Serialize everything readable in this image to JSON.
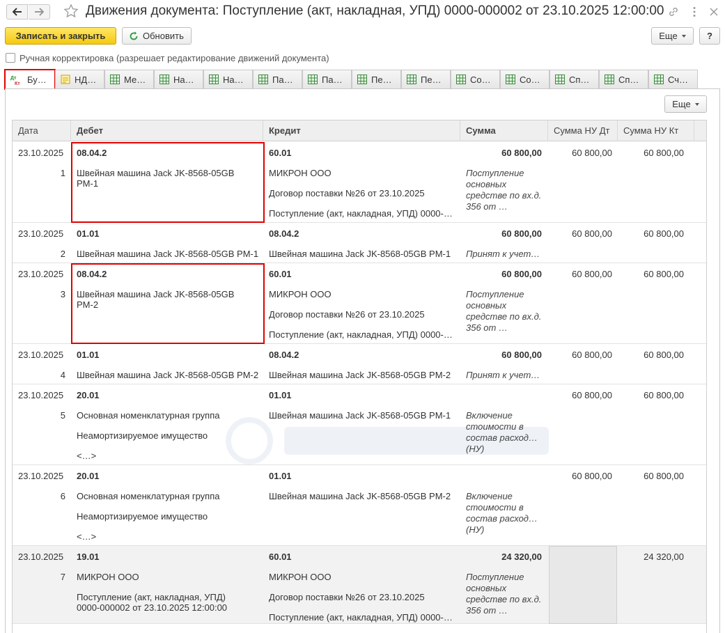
{
  "window": {
    "title": "Движения документа: Поступление (акт, накладная, УПД) 0000-000002 от 23.10.2025 12:00:00"
  },
  "toolbar": {
    "post_close": "Записать и закрыть",
    "refresh": "Обновить",
    "more": "Еще",
    "help": "?"
  },
  "manual_correction": {
    "label": "Ручная корректировка (разрешает редактирование движений документа)",
    "checked": false
  },
  "tabs": [
    {
      "label": "Бу…",
      "icon": "dt-kt-icon",
      "active": true
    },
    {
      "label": "НД…",
      "icon": "register-note-icon"
    },
    {
      "label": "Ме…",
      "icon": "table-icon"
    },
    {
      "label": "На…",
      "icon": "table-icon"
    },
    {
      "label": "На…",
      "icon": "table-icon"
    },
    {
      "label": "Па…",
      "icon": "table-icon"
    },
    {
      "label": "Па…",
      "icon": "table-icon"
    },
    {
      "label": "Пе…",
      "icon": "table-icon"
    },
    {
      "label": "Пе…",
      "icon": "table-icon"
    },
    {
      "label": "Со…",
      "icon": "table-icon"
    },
    {
      "label": "Со…",
      "icon": "table-icon"
    },
    {
      "label": "Сп…",
      "icon": "table-icon"
    },
    {
      "label": "Сп…",
      "icon": "table-icon"
    },
    {
      "label": "Сч…",
      "icon": "table-icon"
    }
  ],
  "table": {
    "more": "Еще",
    "columns": {
      "date": "Дата",
      "debit": "Дебет",
      "credit": "Кредит",
      "sum": "Сумма",
      "sum_nu_dt": "Сумма НУ Дт",
      "sum_nu_kt": "Сумма НУ Кт"
    },
    "rows": [
      {
        "date": "23.10.2025",
        "num": "1",
        "debit_account": "08.04.2",
        "debit_lines": [
          "Швейная машина Jack JK-8568-05GB PM-1"
        ],
        "credit_account": "60.01",
        "credit_lines": [
          "МИКРОН ООО",
          "Договор поставки №26 от 23.10.2025",
          "Поступление (акт, накладная, УПД) 0000-…"
        ],
        "sum": "60 800,00",
        "content": "Поступление основных средстве по вх.д. 356 от …",
        "sum_nu_dt": "60 800,00",
        "sum_nu_kt": "60 800,00"
      },
      {
        "date": "23.10.2025",
        "num": "2",
        "debit_account": "01.01",
        "debit_lines": [
          "Швейная машина Jack JK-8568-05GB PM-1"
        ],
        "credit_account": "08.04.2",
        "credit_lines": [
          "Швейная машина Jack JK-8568-05GB PM-1"
        ],
        "sum": "60 800,00",
        "content": "Принят к учет…",
        "sum_nu_dt": "60 800,00",
        "sum_nu_kt": "60 800,00"
      },
      {
        "date": "23.10.2025",
        "num": "3",
        "debit_account": "08.04.2",
        "debit_lines": [
          "Швейная машина Jack JK-8568-05GB PM-2"
        ],
        "credit_account": "60.01",
        "credit_lines": [
          "МИКРОН ООО",
          "Договор поставки №26 от 23.10.2025",
          "Поступление (акт, накладная, УПД) 0000-…"
        ],
        "sum": "60 800,00",
        "content": "Поступление основных средстве по вх.д. 356 от …",
        "sum_nu_dt": "60 800,00",
        "sum_nu_kt": "60 800,00"
      },
      {
        "date": "23.10.2025",
        "num": "4",
        "debit_account": "01.01",
        "debit_lines": [
          "Швейная машина Jack JK-8568-05GB PM-2"
        ],
        "credit_account": "08.04.2",
        "credit_lines": [
          "Швейная машина Jack JK-8568-05GB PM-2"
        ],
        "sum": "60 800,00",
        "content": "Принят к учет…",
        "sum_nu_dt": "60 800,00",
        "sum_nu_kt": "60 800,00"
      },
      {
        "date": "23.10.2025",
        "num": "5",
        "debit_account": "20.01",
        "debit_lines": [
          "Основная номенклатурная группа",
          "Неамортизируемое имущество",
          "<…>"
        ],
        "credit_account": "01.01",
        "credit_lines": [
          "Швейная машина Jack JK-8568-05GB PM-1"
        ],
        "sum": "",
        "content": "Включение стоимости в состав расход… (НУ)",
        "sum_nu_dt": "60 800,00",
        "sum_nu_kt": "60 800,00"
      },
      {
        "date": "23.10.2025",
        "num": "6",
        "debit_account": "20.01",
        "debit_lines": [
          "Основная номенклатурная группа",
          "Неамортизируемое имущество",
          "<…>"
        ],
        "credit_account": "01.01",
        "credit_lines": [
          "Швейная машина Jack JK-8568-05GB PM-2"
        ],
        "sum": "",
        "content": "Включение стоимости в состав расход… (НУ)",
        "sum_nu_dt": "60 800,00",
        "sum_nu_kt": "60 800,00"
      },
      {
        "date": "23.10.2025",
        "num": "7",
        "debit_account": "19.01",
        "debit_lines": [
          "МИКРОН ООО",
          "Поступление (акт, накладная, УПД) 0000-000002 от 23.10.2025 12:00:00"
        ],
        "credit_account": "60.01",
        "credit_lines": [
          "МИКРОН ООО",
          "Договор поставки №26 от 23.10.2025",
          "Поступление (акт, накладная, УПД) 0000-…"
        ],
        "sum": "24 320,00",
        "content": "Поступление основных средстве по вх.д. 356 от …",
        "sum_nu_dt": "",
        "sum_nu_kt": "24 320,00"
      }
    ]
  },
  "colors": {
    "primary_button": "#f5c90d",
    "highlight": "#e00000",
    "header_bg": "#efefef",
    "alt_row_bg": "#f2f2f2"
  }
}
